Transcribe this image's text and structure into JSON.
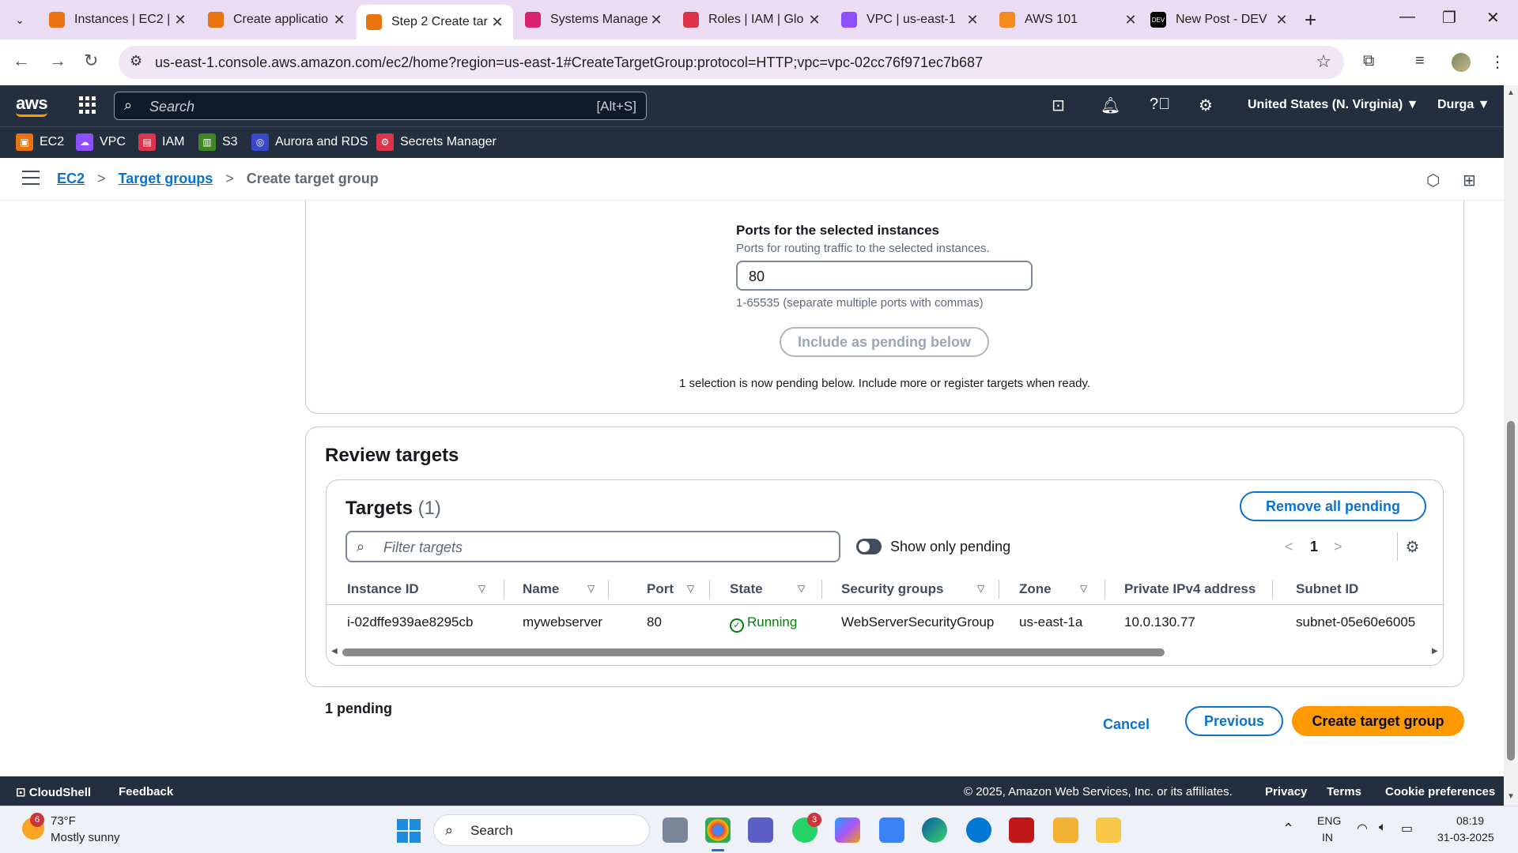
{
  "browser": {
    "tabs": [
      {
        "title": "Instances | EC2 |",
        "favicon_color": "#e8730f"
      },
      {
        "title": "Create applicatio",
        "favicon_color": "#e8730f"
      },
      {
        "title": "Step 2 Create tar",
        "favicon_color": "#e8730f",
        "active": true
      },
      {
        "title": "Systems Manage",
        "favicon_color": "#d6246e"
      },
      {
        "title": "Roles | IAM | Glo",
        "favicon_color": "#dd344c"
      },
      {
        "title": "VPC | us-east-1",
        "favicon_color": "#8c4fff"
      },
      {
        "title": "AWS 101",
        "favicon_color": "#f28b1b"
      },
      {
        "title": "New Post - DEV",
        "favicon_color": "#000000"
      }
    ],
    "url": "us-east-1.console.aws.amazon.com/ec2/home?region=us-east-1#CreateTargetGroup:protocol=HTTP;vpc=vpc-02cc76f971ec7b687"
  },
  "aws_header": {
    "logo": "aws",
    "search_placeholder": "Search",
    "search_shortcut": "[Alt+S]",
    "region": "United States (N. Virginia) ▼",
    "user": "Durga ▼"
  },
  "favorites": [
    {
      "label": "EC2",
      "color": "#e8730f"
    },
    {
      "label": "VPC",
      "color": "#8c4fff"
    },
    {
      "label": "IAM",
      "color": "#dd344c"
    },
    {
      "label": "S3",
      "color": "#3f8624"
    },
    {
      "label": "Aurora and RDS",
      "color": "#3b48cc"
    },
    {
      "label": "Secrets Manager",
      "color": "#dd344c"
    }
  ],
  "breadcrumb": {
    "items": [
      "EC2",
      "Target groups"
    ],
    "current": "Create target group"
  },
  "ports_section": {
    "label": "Ports for the selected instances",
    "description": "Ports for routing traffic to the selected instances.",
    "value": "80",
    "hint": "1-65535 (separate multiple ports with commas)",
    "include_button": "Include as pending below",
    "pending_note": "1 selection is now pending below. Include more or register targets when ready."
  },
  "review": {
    "title": "Review targets",
    "table_title": "Targets",
    "count": "(1)",
    "remove_button": "Remove all pending",
    "filter_placeholder": "Filter targets",
    "toggle_label": "Show only pending",
    "page": "1",
    "columns": [
      "Instance ID",
      "Name",
      "Port",
      "State",
      "Security groups",
      "Zone",
      "Private IPv4 address",
      "Subnet ID"
    ],
    "rows": [
      {
        "instance_id": "i-02dffe939ae8295cb",
        "name": "mywebserver",
        "port": "80",
        "state": "Running",
        "security_groups": "WebServerSecurityGroup",
        "zone": "us-east-1a",
        "private_ip": "10.0.130.77",
        "subnet_id": "subnet-05e60e6005"
      }
    ]
  },
  "footer_actions": {
    "pending_count": "1 pending",
    "cancel": "Cancel",
    "previous": "Previous",
    "create": "Create target group"
  },
  "aws_footer": {
    "cloudshell": "CloudShell",
    "feedback": "Feedback",
    "copyright": "© 2025, Amazon Web Services, Inc. or its affiliates.",
    "privacy": "Privacy",
    "terms": "Terms",
    "cookies": "Cookie preferences"
  },
  "taskbar": {
    "weather_badge": "6",
    "temperature": "73°F",
    "weather": "Mostly sunny",
    "search": "Search",
    "teams_badge": "3",
    "lang1": "ENG",
    "lang2": "IN",
    "time": "08:19",
    "date": "31-03-2025"
  }
}
